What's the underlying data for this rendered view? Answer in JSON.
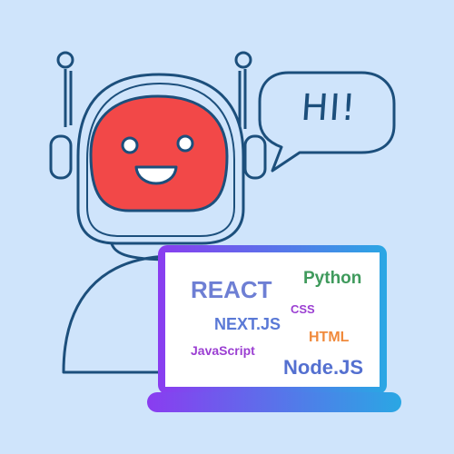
{
  "speech_bubble": {
    "text": "HI!"
  },
  "laptop": {
    "words": [
      {
        "id": "react",
        "text": "REACT",
        "color": "#6e7fd4"
      },
      {
        "id": "python",
        "text": "Python",
        "color": "#3f9a5c"
      },
      {
        "id": "css",
        "text": "CSS",
        "color": "#9b3fd2"
      },
      {
        "id": "nextjs",
        "text": "NEXT.JS",
        "color": "#5a79d6"
      },
      {
        "id": "html",
        "text": "HTML",
        "color": "#f08a3c"
      },
      {
        "id": "javascript",
        "text": "JavaScript",
        "color": "#9b3fd2"
      },
      {
        "id": "nodejs",
        "text": "Node.JS",
        "color": "#5470d0"
      }
    ]
  },
  "colors": {
    "background": "#cfe4fb",
    "outline": "#1c4f7c",
    "face": "#f24848",
    "laptop_gradient_start": "#8a3cf0",
    "laptop_gradient_end": "#2aa7e4"
  }
}
